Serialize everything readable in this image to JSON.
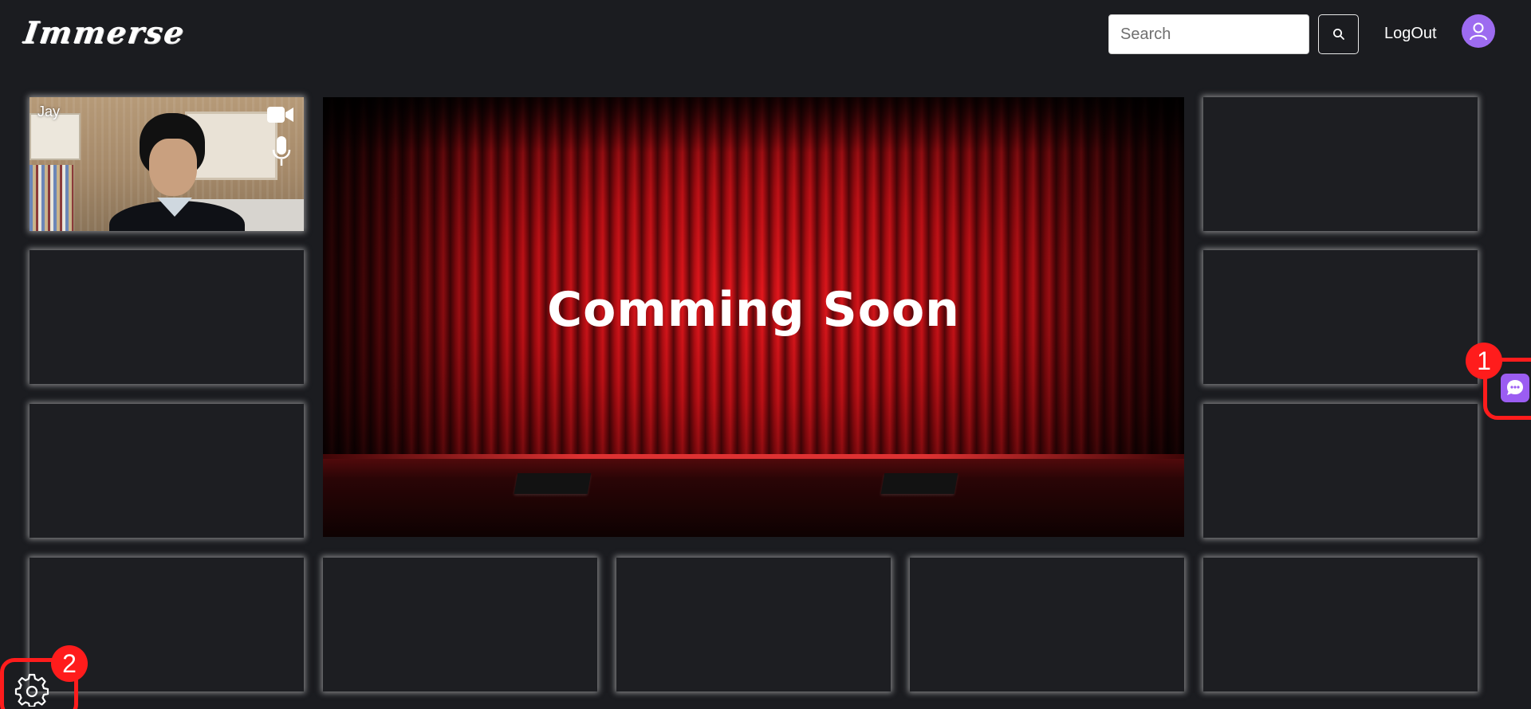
{
  "header": {
    "logo_text": "Immerse",
    "search_placeholder": "Search",
    "search_button_icon": "search-icon",
    "logout_label": "LogOut",
    "avatar_icon": "user-icon"
  },
  "self_tile": {
    "participant_name": "Jay",
    "camera_icon": "video-camera-icon",
    "mic_icon": "microphone-icon"
  },
  "stage": {
    "title": "Comming Soon"
  },
  "floating": {
    "chat_icon": "chat-bubble-icon",
    "settings_icon": "gear-icon"
  },
  "annotations": {
    "marker_1": "1",
    "marker_2": "2"
  },
  "colors": {
    "background": "#1b1c20",
    "accent_purple": "#9b5df2",
    "avatar_purple": "#9d6bf0",
    "annotation_red": "#ff1c1c",
    "curtain_red": "#c8101a"
  }
}
